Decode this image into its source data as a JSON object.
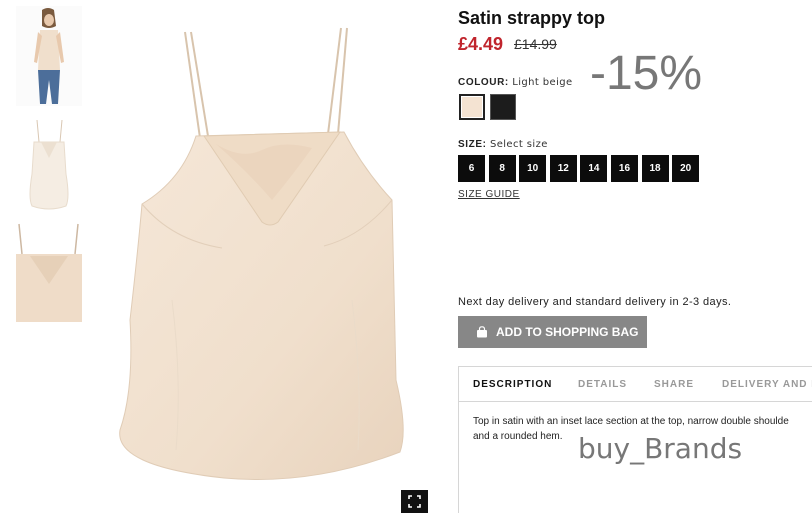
{
  "product": {
    "title": "Satin strappy top",
    "price": "£4.49",
    "old_price": "£14.99",
    "discount_badge": "-15%"
  },
  "colour": {
    "label": "COLOUR:",
    "value": "Light beige",
    "swatches": [
      {
        "name": "Light beige",
        "color": "#f4e3d2",
        "selected": true
      },
      {
        "name": "Black",
        "color": "#1c1c1c",
        "selected": false
      }
    ]
  },
  "size": {
    "label": "SIZE:",
    "value": "Select size",
    "options": [
      "6",
      "8",
      "10",
      "12",
      "14",
      "16",
      "18",
      "20"
    ],
    "guide_label": "SIZE GUIDE"
  },
  "delivery_text": "Next day delivery and standard delivery in 2-3 days.",
  "add_to_bag_label": "ADD TO SHOPPING BAG",
  "tabs": [
    "DESCRIPTION",
    "DETAILS",
    "SHARE",
    "DELIVERY AND P"
  ],
  "description": {
    "line1": "Top in satin with an inset lace section at the top, narrow double shoulde",
    "line2": "and a rounded hem."
  },
  "watermark": "buy_Brands",
  "colors": {
    "price_red": "#c0242c",
    "button_gray": "#878787",
    "product_beige": "#f2e2d1"
  },
  "icons": [
    "bag-icon",
    "fullscreen-icon"
  ]
}
